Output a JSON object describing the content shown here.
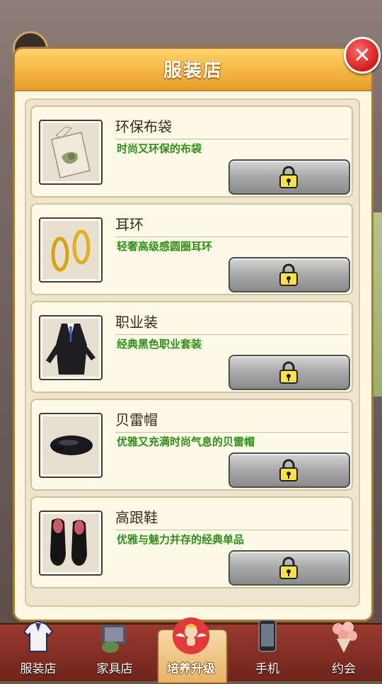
{
  "dialog": {
    "title": "服装店",
    "close_icon": "close-x-icon"
  },
  "items": [
    {
      "name": "环保布袋",
      "desc": "时尚又环保的布袋",
      "icon": "tote-bag-icon",
      "locked": true
    },
    {
      "name": "耳环",
      "desc": "轻奢高级感圆圈耳环",
      "icon": "hoop-earrings-icon",
      "locked": true
    },
    {
      "name": "职业装",
      "desc": "经典黑色职业套装",
      "icon": "business-suit-icon",
      "locked": true
    },
    {
      "name": "贝雷帽",
      "desc": "优雅又充满时尚气息的贝雷帽",
      "icon": "beret-icon",
      "locked": true
    },
    {
      "name": "高跟鞋",
      "desc": "优雅与魅力并存的经典单品",
      "icon": "high-heels-icon",
      "locked": true
    }
  ],
  "tabs": [
    {
      "label": "服装店",
      "icon": "clothing-icon",
      "active": false
    },
    {
      "label": "家具店",
      "icon": "furniture-icon",
      "active": false
    },
    {
      "label": "培养升级",
      "icon": "cupid-icon",
      "active": true
    },
    {
      "label": "手机",
      "icon": "phone-icon",
      "active": false
    },
    {
      "label": "约会",
      "icon": "bouquet-icon",
      "active": false
    }
  ],
  "colors": {
    "header": "#f3b23e",
    "desc_text": "#2f8f18",
    "close_button": "#d51b1b",
    "tabbar": "#7e2b22"
  }
}
